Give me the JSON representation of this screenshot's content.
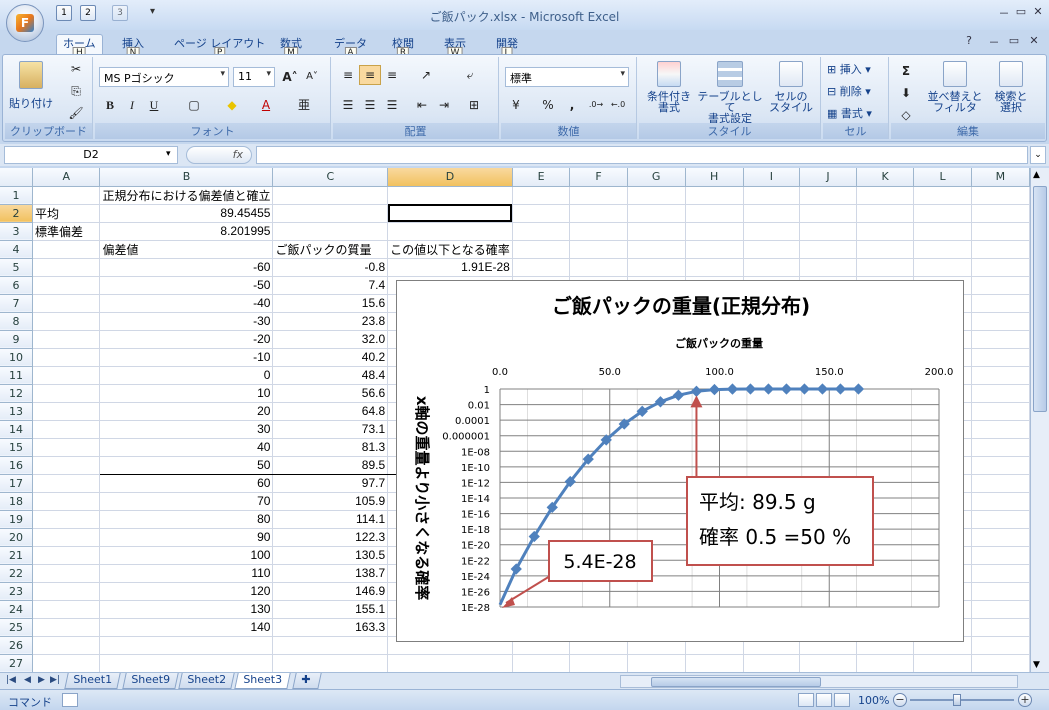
{
  "title_bar": {
    "window_title": "ご飯パック.xlsx - Microsoft Excel",
    "office_logo": "F",
    "qat_tips": [
      "1",
      "2",
      "3"
    ],
    "window_buttons": [
      "－",
      "▭",
      "✕"
    ]
  },
  "ribbon_tabs": [
    {
      "label": "ホーム",
      "key": "H"
    },
    {
      "label": "挿入",
      "key": "N"
    },
    {
      "label": "ページ レイアウト",
      "key": "P"
    },
    {
      "label": "数式",
      "key": "M"
    },
    {
      "label": "データ",
      "key": "A"
    },
    {
      "label": "校閲",
      "key": "R"
    },
    {
      "label": "表示",
      "key": "W"
    },
    {
      "label": "開発",
      "key": "L"
    }
  ],
  "ribbon": {
    "clipboard": {
      "label": "クリップボード",
      "paste": "貼り付け"
    },
    "font": {
      "label": "フォント",
      "name": "MS Pゴシック",
      "size": "11",
      "bold": "B",
      "italic": "I",
      "underline": "U",
      "grow": "A˄",
      "shrink": "A˅",
      "phonetic": "亜",
      "font_color_letter": "A"
    },
    "alignment": {
      "label": "配置"
    },
    "number": {
      "label": "数値",
      "format": "標準",
      "percent": "%",
      "comma": ","
    },
    "styles": {
      "label": "スタイル",
      "conditional": "条件付き\n書式",
      "table": "テーブルとして\n書式設定",
      "cell": "セルの\nスタイル"
    },
    "cells": {
      "label": "セル",
      "insert": "挿入",
      "delete": "削除",
      "format": "書式"
    },
    "editing": {
      "label": "編集",
      "sum": "Σ",
      "sort": "並べ替えと\nフィルタ",
      "find": "検索と\n選択"
    }
  },
  "formula_bar": {
    "name_box": "D2",
    "fx": "fx",
    "content": ""
  },
  "grid": {
    "columns": [
      "A",
      "B",
      "C",
      "D",
      "E",
      "F",
      "G",
      "H",
      "I",
      "J",
      "K",
      "L",
      "M"
    ],
    "rows": [
      [
        "",
        "正規分布における偏差値と確立",
        "",
        "",
        ""
      ],
      [
        "平均",
        "89.45455",
        "",
        "",
        ""
      ],
      [
        "標準偏差",
        "8.201995",
        "",
        "",
        ""
      ],
      [
        "",
        "偏差値",
        "ご飯パックの質量",
        "この値以下となる確率",
        ""
      ],
      [
        "",
        "-60",
        "-0.8",
        "1.91E-28",
        ""
      ],
      [
        "",
        "-50",
        "7.4",
        "7.62E-24",
        ""
      ],
      [
        "",
        "-40",
        "15.6",
        "1.13E-19",
        ""
      ],
      [
        "",
        "-30",
        "23.8",
        "6.22E-16",
        ""
      ],
      [
        "",
        "-20",
        "32.0",
        "1.28E-12",
        ""
      ],
      [
        "",
        "-10",
        "40.2",
        "9.87E-10",
        ""
      ],
      [
        "",
        "0",
        "48.4",
        "2.87E-07",
        ""
      ],
      [
        "",
        "10",
        "56.6",
        "3.17E-05",
        ""
      ],
      [
        "",
        "20",
        "64.8",
        "0.00135",
        ""
      ],
      [
        "",
        "30",
        "73.1",
        "0.02275",
        ""
      ],
      [
        "",
        "40",
        "81.3",
        "0.158655",
        ""
      ],
      [
        "",
        "50",
        "89.5",
        "0.5",
        ""
      ],
      [
        "",
        "60",
        "97.7",
        "0.841345",
        ""
      ],
      [
        "",
        "70",
        "105.9",
        "0.97725",
        ""
      ],
      [
        "",
        "80",
        "114.1",
        "0.99865",
        ""
      ],
      [
        "",
        "90",
        "122.3",
        "0.999968",
        ""
      ],
      [
        "",
        "100",
        "130.5",
        "1",
        ""
      ],
      [
        "",
        "110",
        "138.7",
        "1",
        ""
      ],
      [
        "",
        "120",
        "146.9",
        "1",
        ""
      ],
      [
        "",
        "130",
        "155.1",
        "1",
        ""
      ],
      [
        "",
        "140",
        "163.3",
        "1",
        ""
      ],
      [
        "",
        "",
        "",
        "",
        ""
      ],
      [
        "",
        "",
        "",
        "",
        ""
      ]
    ]
  },
  "chart_data": {
    "type": "scatter",
    "title": "ご飯パックの重量(正規分布)",
    "xlabel": "ご飯パックの重量",
    "ylabel": "x軸の重量より小さくなる確率",
    "x_axis_position": "top",
    "xlim": [
      0,
      200
    ],
    "x_ticks": [
      "0.0",
      "50.0",
      "100.0",
      "150.0",
      "200.0"
    ],
    "y_scale": "log",
    "y_ticks": [
      "1",
      "0.01",
      "0.0001",
      "0.000001",
      "1E-08",
      "1E-10",
      "1E-12",
      "1E-14",
      "1E-16",
      "1E-18",
      "1E-20",
      "1E-22",
      "1E-24",
      "1E-26",
      "1E-28"
    ],
    "grid": true,
    "x": [
      -0.8,
      7.4,
      15.6,
      23.8,
      32.0,
      40.2,
      48.4,
      56.6,
      64.8,
      73.1,
      81.3,
      89.5,
      97.7,
      105.9,
      114.1,
      122.3,
      130.5,
      138.7,
      146.9,
      155.1,
      163.3
    ],
    "y": [
      1.91e-28,
      7.62e-24,
      1.13e-19,
      6.22e-16,
      1.28e-12,
      9.87e-10,
      2.87e-07,
      3.17e-05,
      0.00135,
      0.02275,
      0.158655,
      0.5,
      0.841345,
      0.97725,
      0.99865,
      0.999968,
      1,
      1,
      1,
      1,
      1
    ],
    "series_color": "#4f81bd",
    "annotations": [
      {
        "text": "5.4E-28",
        "target_x": 0,
        "target_y": 1e-28
      },
      {
        "text": "平均: 89.5 g",
        "text2": "確率 0.5 =50 %",
        "target_x": 89.5,
        "target_y": 0.5
      }
    ],
    "annotation_color": "#c0504d"
  },
  "sheet_tabs": [
    "Sheet1",
    "Sheet9",
    "Sheet2",
    "Sheet3"
  ],
  "active_sheet": "Sheet3",
  "status_bar": {
    "mode": "コマンド",
    "zoom": "100%"
  }
}
